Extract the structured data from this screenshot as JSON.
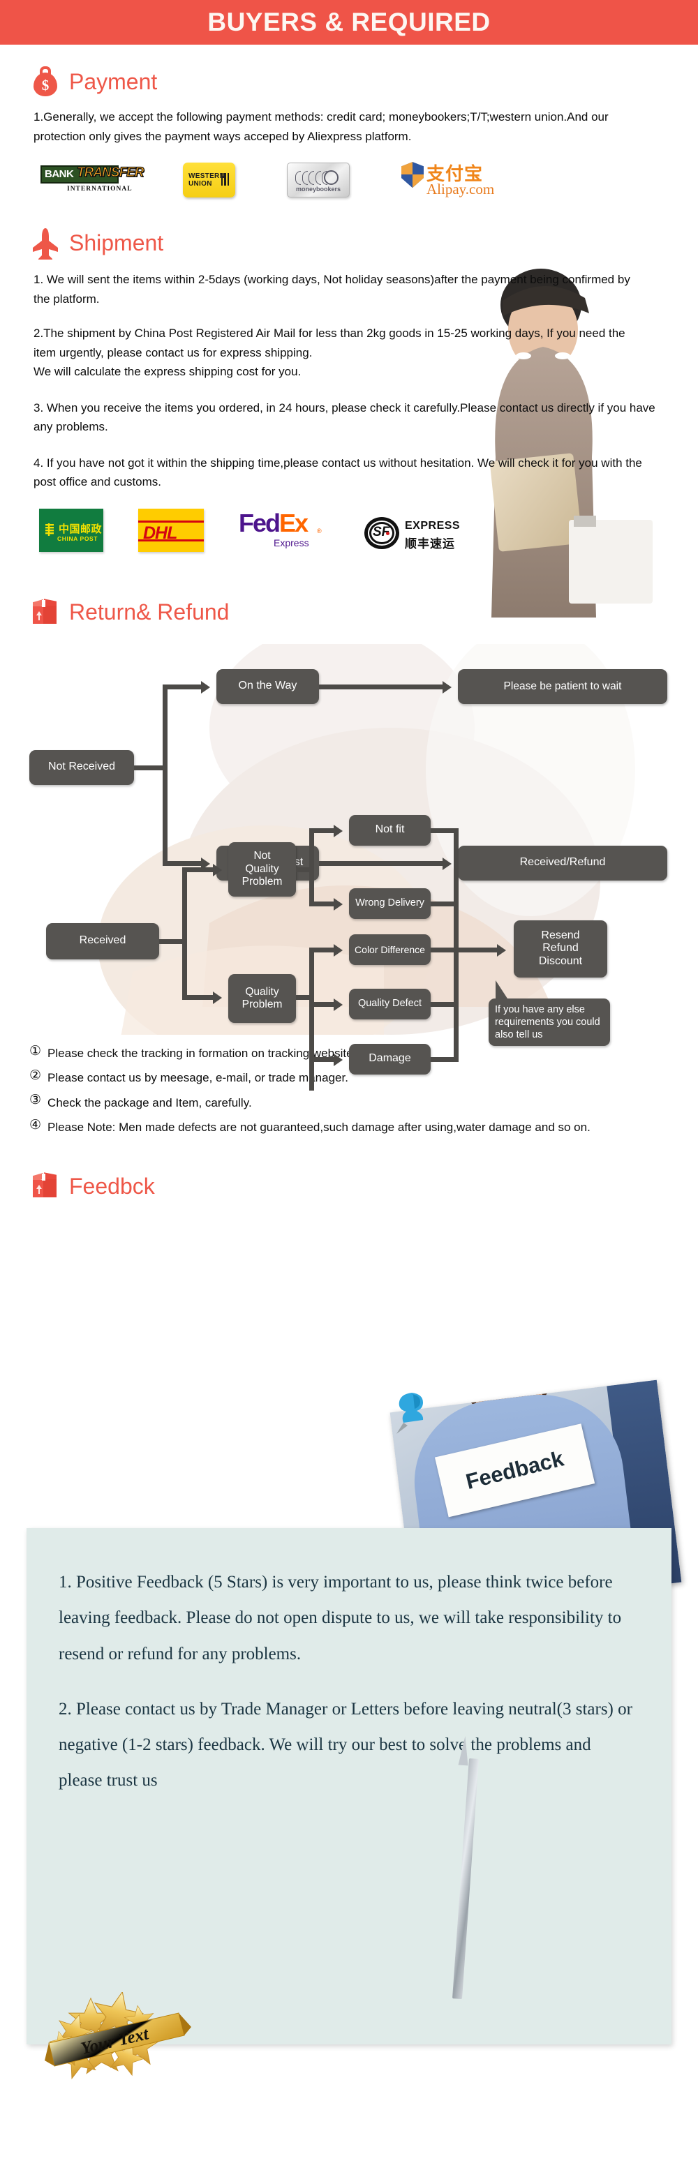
{
  "header": {
    "title": "BUYERS & REQUIRED",
    "bg_color": "#ef5448",
    "text_color": "#fdf7f2"
  },
  "accent_color": "#ee5748",
  "sections": {
    "payment": {
      "heading": "Payment",
      "icon": "money-bag-icon",
      "paragraph": "1.Generally, we accept the following payment methods: credit card; moneybookers;T/T;western union.And our protection only gives the payment ways acceped by Aliexpress platform.",
      "logos": [
        {
          "id": "bank-transfer",
          "line1": "BANK",
          "line2": "TRANSFER",
          "line3": "INTERNATIONAL"
        },
        {
          "id": "western-union",
          "line1": "WESTERN",
          "line2": "UNION"
        },
        {
          "id": "moneybookers",
          "line1": "moneybookers"
        },
        {
          "id": "alipay",
          "line1": "支付宝",
          "line2": "Alipay.com"
        }
      ]
    },
    "shipment": {
      "heading": "Shipment",
      "icon": "airplane-icon",
      "paragraphs": [
        "1. We will sent the items within 2-5days (working days, Not holiday seasons)after the payment being confirmed by the platform.",
        "2.The shipment by China Post Registered Air Mail for less than  2kg goods in 15-25 working days, If  you need the item urgently, please contact us for express shipping.\nWe will calculate the express shipping cost for you.",
        "3. When you receive the items you ordered, in 24 hours, please check  it carefully.Please contact us directly if you have any problems.",
        "4. If you have not got it within the shipping time,please contact us without hesitation. We will check it for you with the post office and customs."
      ],
      "logos": [
        {
          "id": "china-post",
          "cn": "中国邮政",
          "en": "CHINA POST"
        },
        {
          "id": "dhl",
          "text": "DHL"
        },
        {
          "id": "fedex",
          "fed": "Fed",
          "ex": "Ex",
          "sub": "Express",
          "reg": "®"
        },
        {
          "id": "sf-express",
          "letters": "SF",
          "en": "EXPRESS",
          "cn": "顺丰速运"
        }
      ]
    },
    "return_refund": {
      "heading": "Return& Refund",
      "icon": "return-box-icon",
      "flowchart": {
        "nodes": [
          {
            "id": "not-received",
            "label": "Not Received"
          },
          {
            "id": "on-the-way",
            "label": "On the Way"
          },
          {
            "id": "please-wait",
            "label": "Please be patient to wait"
          },
          {
            "id": "received-lost",
            "label": "Received/Lost"
          },
          {
            "id": "received-refund",
            "label": "Received/Refund"
          },
          {
            "id": "received",
            "label": "Received"
          },
          {
            "id": "not-quality-problem",
            "label": "Not\nQuality\nProblem"
          },
          {
            "id": "quality-problem",
            "label": "Quality\nProblem"
          },
          {
            "id": "not-fit",
            "label": "Not fit"
          },
          {
            "id": "wrong-delivery",
            "label": "Wrong Delivery"
          },
          {
            "id": "color-difference",
            "label": "Color Difference"
          },
          {
            "id": "quality-defect",
            "label": "Quality Defect"
          },
          {
            "id": "damage",
            "label": "Damage"
          },
          {
            "id": "resend-refund-discount",
            "label": "Resend\nRefund\nDiscount"
          }
        ],
        "callout": "If you have any else requirements you could also tell us",
        "node_color": "#565451",
        "line_color": "#4c4a47"
      },
      "notes": [
        {
          "num": "①",
          "text": "Please check the tracking in formation on tracking website."
        },
        {
          "num": "②",
          "text": "Please contact us by meesage, e-mail, or trade manager."
        },
        {
          "num": "③",
          "text": "Check the package and Item, carefully."
        },
        {
          "num": "④",
          "text": "Please Note: Men made defects  are not guaranteed,such damage after using,water damage and so on."
        }
      ]
    },
    "feedback": {
      "heading": "Feedbck",
      "icon": "return-box-icon",
      "photo_sign_text": "Feedback",
      "panel_bg": "#e0ebe9",
      "paragraphs": [
        "1. Positive Feedback (5 Stars) is very important to us, please think twice before leaving feedback. Please do not open dispute to us,   we will take responsibility to resend or refund for any problems.",
        "2. Please contact us by Trade Manager or Letters before leaving neutral(3 stars) or negative (1-2 stars) feedback. We will try our best to solve the problems and please trust us"
      ],
      "badge_text": "Your Text"
    }
  }
}
